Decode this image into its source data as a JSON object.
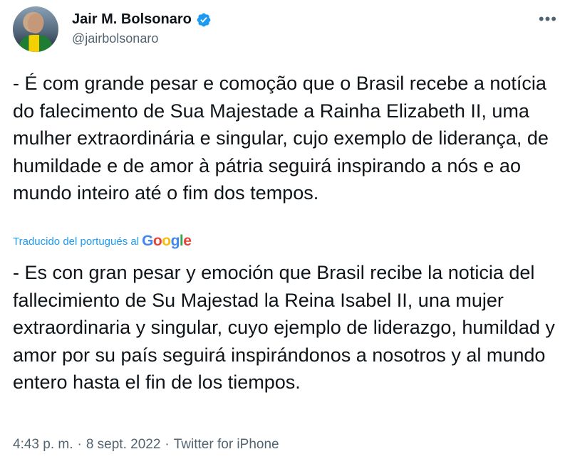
{
  "author": {
    "display_name": "Jair M. Bolsonaro",
    "handle": "@jairbolsonaro",
    "verified_icon": "verified-badge-icon",
    "verified_color": "#1d9bf0"
  },
  "menu_icon": "more-options-icon",
  "tweet": {
    "original_text": "- É com grande pesar e comoção que o Brasil recebe a notícia do falecimento de Sua Majestade a Rainha Elizabeth II, uma mulher extraordinária e singular, cujo exemplo de liderança, de humildade e de amor à pátria seguirá inspirando a nós e ao mundo inteiro até o fim dos tempos.",
    "translation_label": "Traducido del portugués al",
    "translation_provider": {
      "letters": [
        "G",
        "o",
        "o",
        "g",
        "l",
        "e"
      ]
    },
    "translated_text": "- Es con gran pesar y emoción que Brasil recibe la noticia del fallecimiento de Su Majestad la Reina Isabel II, una mujer extraordinaria y singular, cuyo ejemplo de liderazgo, humildad y amor por su país seguirá inspirándonos a nosotros y al mundo entero hasta el fin de los tiempos."
  },
  "meta": {
    "time": "4:43 p. m.",
    "separator": "·",
    "date": "8 sept. 2022",
    "source": "Twitter for iPhone"
  },
  "colors": {
    "text_primary": "#0f1419",
    "text_secondary": "#536471",
    "link": "#1d9bf0"
  }
}
